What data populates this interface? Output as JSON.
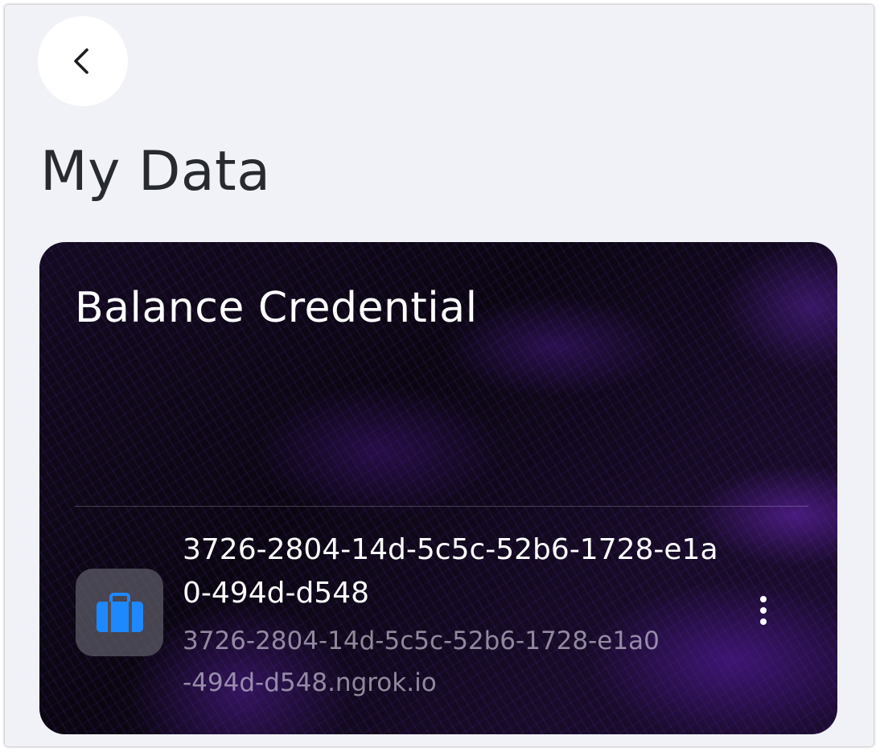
{
  "header": {
    "back_icon": "chevron-left-icon",
    "title": "My Data"
  },
  "credential_card": {
    "title": "Balance Credential",
    "entry": {
      "icon": "briefcase-icon",
      "icon_color": "#1e88ff",
      "name": "3726-2804-14d-5c5c-52b6-1728-e1a0-494d-d548",
      "url": "3726-2804-14d-5c5c-52b6-1728-e1a0-494d-d548.ngrok.io",
      "menu_icon": "more-vertical-icon"
    }
  },
  "colors": {
    "background": "#f1f2f7",
    "title_text": "#272a2e",
    "card_base": "#0c0711",
    "card_accent": "#6a2ab8"
  }
}
